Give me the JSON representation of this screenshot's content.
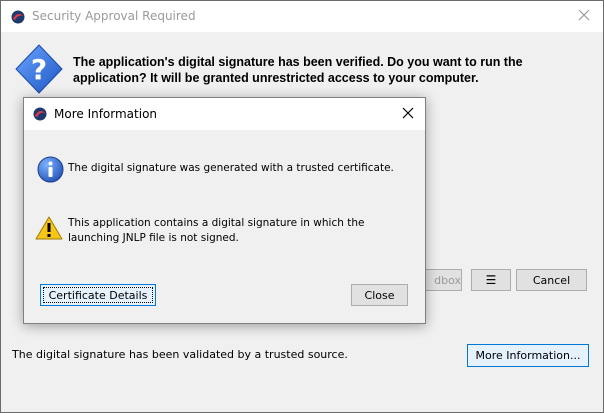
{
  "main_window": {
    "title": "Security Approval Required",
    "message": "The application's digital signature has been verified. Do you want to run the application? It will be granted unrestricted access to your computer.",
    "buttons": {
      "sandbox_partial": "dbox",
      "menu_glyph": "☰",
      "cancel": "Cancel",
      "more_info": "More Information..."
    },
    "status": "The digital signature has been validated by a trusted source."
  },
  "dialog": {
    "title": "More Information",
    "info_message": "The digital signature was generated with a trusted certificate.",
    "warning_message": "This application contains a digital signature in which the launching JNLP file is not signed.",
    "buttons": {
      "certificate_details": "Certificate Details",
      "close": "Close"
    }
  },
  "icons": {
    "app": "java-app-icon",
    "question": "question-icon",
    "info": "info-icon",
    "warning": "warning-icon",
    "close": "close-icon"
  },
  "colors": {
    "info_blue": "#2a62c9",
    "question_blue": "#2f6fd1",
    "warning_yellow": "#f5c518",
    "focus_blue": "#0078d7"
  }
}
